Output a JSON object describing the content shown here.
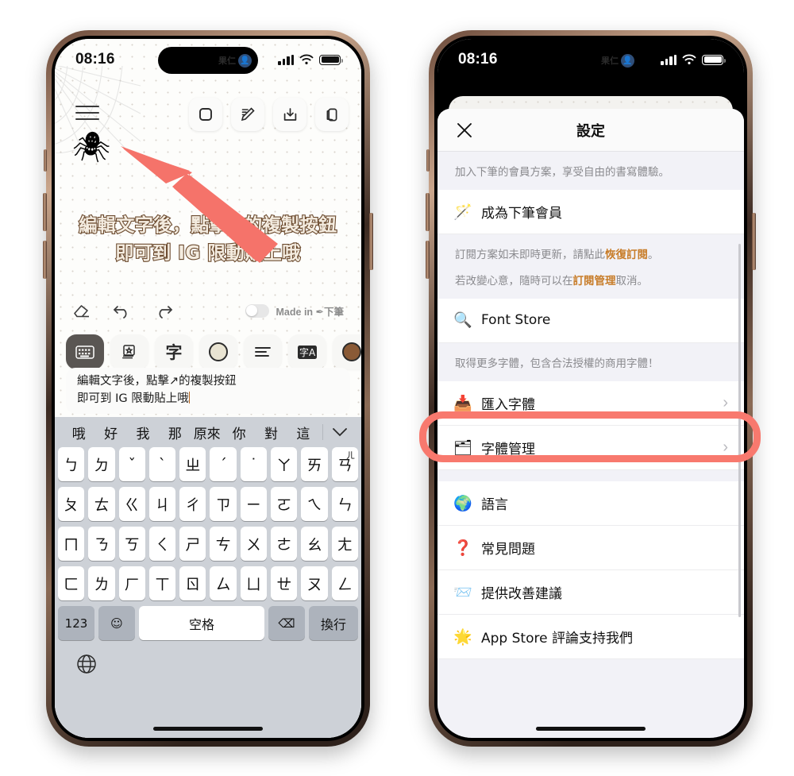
{
  "left_phone": {
    "status": {
      "time": "08:16",
      "island_name": "果仁",
      "island_avatar": "👤"
    },
    "note": {
      "hamburger": "menu-icon",
      "spider": "🕷",
      "top_tools": [
        {
          "name": "canvas-size-button",
          "icon": "square"
        },
        {
          "name": "edit-pen-button",
          "icon": "pencil"
        },
        {
          "name": "save-button",
          "icon": "download-tray"
        },
        {
          "name": "copy-button",
          "icon": "duplicate"
        }
      ],
      "text_lines": [
        "編輯文字後，點擊↗的複製按鈕",
        "即可到 IG 限動貼上哦"
      ],
      "text_color": "#f4ece0",
      "text_stroke_color": "#6b4a2e"
    },
    "editbar": {
      "eraser": "eraser-icon",
      "undo": "undo-icon",
      "redo": "redo-icon",
      "watermark_toggle_on": false,
      "watermark_label": "Made in ✒下筆"
    },
    "stylebar": [
      {
        "name": "keyboard-tool",
        "glyph": "⌨",
        "active": true
      },
      {
        "name": "sticker-tool",
        "glyph": "🖼",
        "active": false
      },
      {
        "name": "font-tool",
        "glyph": "字",
        "active": false
      },
      {
        "name": "color-tool",
        "glyph": "circle",
        "active": false,
        "color": "#e9e4d2"
      },
      {
        "name": "align-tool",
        "glyph": "≡",
        "active": false
      },
      {
        "name": "translate-tool",
        "glyph": "字A",
        "active": false
      },
      {
        "name": "stroke-color-tool",
        "glyph": "circle",
        "active": false,
        "color": "#8a5a36"
      }
    ],
    "input": {
      "line1": "編輯文字後，點擊↗的複製按鈕",
      "line2": "即可到 IG 限動貼上哦"
    },
    "keyboard": {
      "suggestions": [
        "哦",
        "好",
        "我",
        "那",
        "原來",
        "你",
        "對",
        "這"
      ],
      "collapse_icon": "chevron-down-icon",
      "row1": [
        {
          "k": "ㄅ"
        },
        {
          "k": "ㄉ"
        },
        {
          "k": "ˇ"
        },
        {
          "k": "ˋ"
        },
        {
          "k": "ㄓ"
        },
        {
          "k": "ˊ"
        },
        {
          "k": "˙"
        },
        {
          "k": "ㄚ"
        },
        {
          "k": "ㄞ"
        },
        {
          "k": "ㄢ",
          "sup": "ㄦ"
        }
      ],
      "row2": [
        "ㄆ",
        "ㄊ",
        "ㄍ",
        "ㄐ",
        "ㄔ",
        "ㄗ",
        "ㄧ",
        "ㄛ",
        "ㄟ",
        "ㄣ"
      ],
      "row3": [
        "ㄇ",
        "ㄋ",
        "ㄎ",
        "ㄑ",
        "ㄕ",
        "ㄘ",
        "ㄨ",
        "ㄜ",
        "ㄠ",
        "ㄤ"
      ],
      "row4": [
        "ㄈ",
        "ㄌ",
        "ㄏ",
        "ㄒ",
        "ㄖ",
        "ㄙ",
        "ㄩ",
        "ㄝ",
        "ㄡ",
        "ㄥ"
      ],
      "bottom": {
        "numeric": "123",
        "emoji": "☺",
        "space": "空格",
        "backspace": "⌫",
        "newline": "換行",
        "globe": "globe-icon"
      }
    }
  },
  "right_phone": {
    "status": {
      "time": "08:16",
      "island_name": "果仁",
      "island_avatar": "👤"
    },
    "sheet": {
      "close_icon": "close-icon",
      "title": "設定",
      "membership_note": "加入下筆的會員方案，享受自由的書寫體驗。",
      "rows": [
        {
          "icon": "🪄",
          "label": "成為下筆會員",
          "chevron": false,
          "name": "row-become-member"
        }
      ],
      "sub_note_1_pre": "訂閱方案如未即時更新，請點此",
      "sub_note_1_link": "恢復訂閱",
      "sub_note_1_post": "。",
      "sub_note_2_pre": "若改變心意，隨時可以在",
      "sub_note_2_link": "訂閱管理",
      "sub_note_2_post": "取消。",
      "font_store": {
        "icon": "🔍",
        "label": "Font Store",
        "name": "row-font-store"
      },
      "font_store_note": "取得更多字體，包含合法授權的商用字體！",
      "import_font": {
        "icon": "📥",
        "label": "匯入字體",
        "chevron": "›",
        "name": "row-import-font"
      },
      "manage_font": {
        "icon": "🗂",
        "label": "字體管理",
        "chevron": "›",
        "name": "row-manage-font"
      },
      "language": {
        "icon": "🌍",
        "label": "語言",
        "name": "row-language"
      },
      "faq": {
        "icon": "❓",
        "label": "常見問題",
        "name": "row-faq"
      },
      "feedback": {
        "icon": "📨",
        "label": "提供改善建議",
        "name": "row-feedback"
      },
      "rate": {
        "icon": "🌟",
        "label": "App Store 評論支持我們",
        "name": "row-rate"
      }
    },
    "highlight_color": "#f8796e"
  }
}
